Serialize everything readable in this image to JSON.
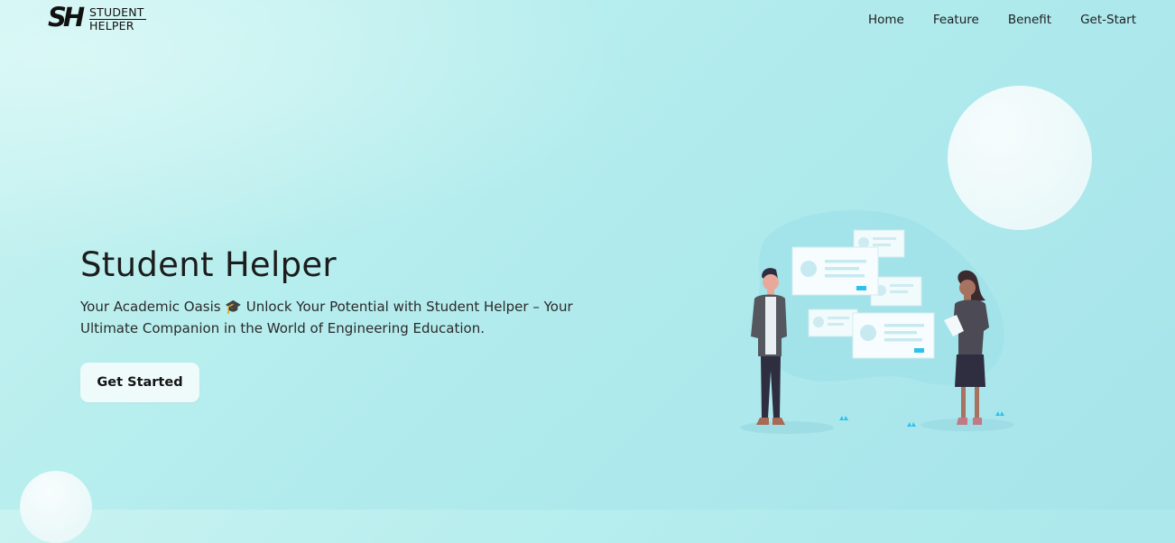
{
  "brand": {
    "mark": "SH",
    "line1": "STUDENT",
    "line2": "HELPER"
  },
  "nav": {
    "items": [
      "Home",
      "Feature",
      "Benefit",
      "Get-Start"
    ]
  },
  "hero": {
    "title": "Student Helper",
    "subtitle": "Your Academic Oasis 🎓 Unlock Your Potential with Student Helper – Your Ultimate Companion in the World of Engineering Education.",
    "cta_label": "Get Started"
  },
  "colors": {
    "background": "#aee9ec",
    "accent": "#2fc1ec",
    "button_bg": "#effbfb"
  },
  "illustration": {
    "name": "two-people-with-floating-cards"
  }
}
